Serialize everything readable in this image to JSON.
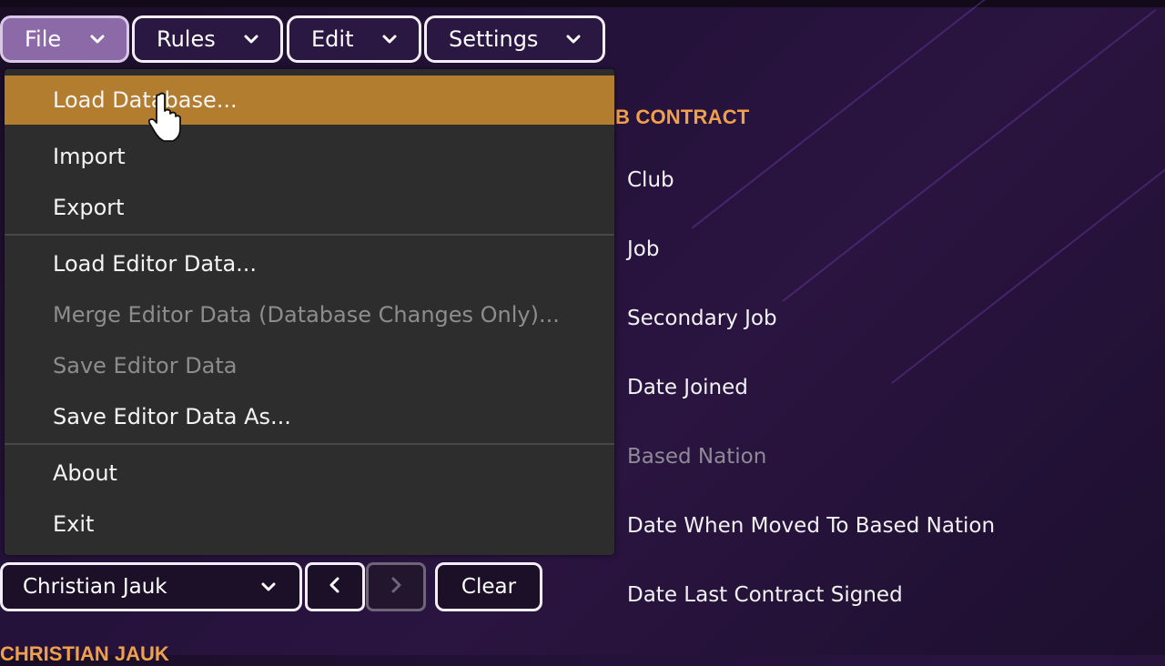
{
  "menu_bar": {
    "file": "File",
    "rules": "Rules",
    "edit": "Edit",
    "settings": "Settings"
  },
  "file_menu": {
    "load_database": "Load Database...",
    "import": "Import",
    "export": "Export",
    "load_editor_data": "Load Editor Data...",
    "merge_editor_data": "Merge Editor Data (Database Changes Only)...",
    "save_editor_data": "Save Editor Data",
    "save_editor_data_as": "Save Editor Data As...",
    "about": "About",
    "exit": "Exit"
  },
  "panel": {
    "section_title": "B CONTRACT",
    "fields": {
      "club": "Club",
      "job": "Job",
      "secondary_job": "Secondary Job",
      "date_joined": "Date Joined",
      "based_nation": "Based Nation",
      "date_moved": "Date When Moved To Based Nation",
      "date_last_contract": "Date Last Contract Signed"
    }
  },
  "controls": {
    "person_select": "Christian Jauk",
    "clear": "Clear"
  },
  "footer": {
    "title": "CHRISTIAN JAUK"
  },
  "colors": {
    "accent_orange": "#f0a04a",
    "highlight": "#b27d2f",
    "menu_bg": "#2d2d2d"
  }
}
